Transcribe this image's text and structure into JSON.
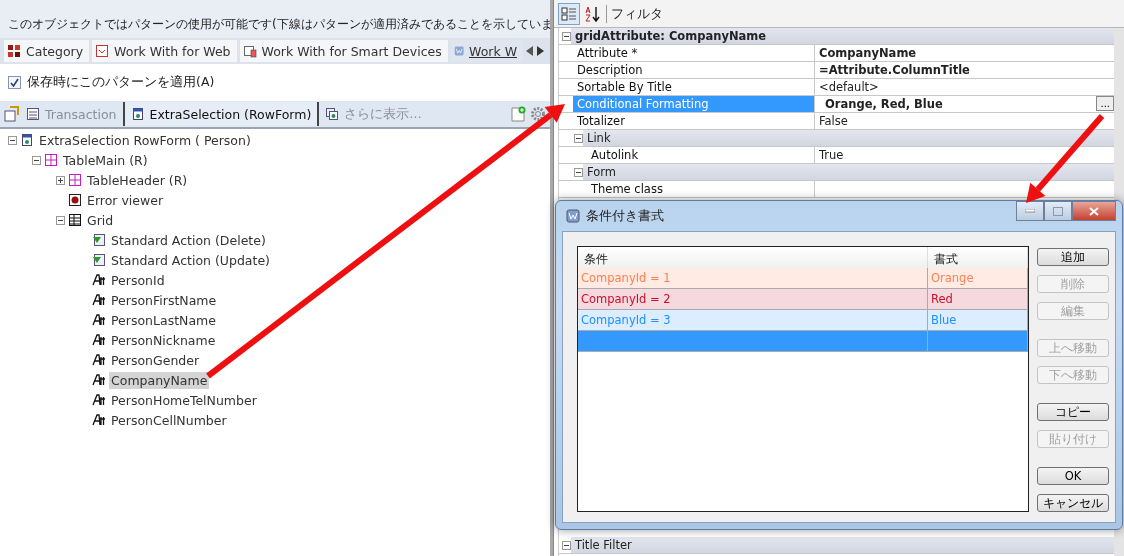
{
  "left_panel": {
    "notice": "このオブジェクトではパターンの使用が可能です(下線はパターンが適用済みであることを示していま",
    "tabs": [
      {
        "label": "Category",
        "kind": "category",
        "selected": false
      },
      {
        "label": "Work With for Web",
        "kind": "web",
        "selected": false
      },
      {
        "label": "Work With for Smart Devices",
        "kind": "devices",
        "selected": false
      },
      {
        "label": "Work W",
        "kind": "workwith",
        "selected": true
      }
    ],
    "apply_on_save": {
      "label": "保存時にこのパターンを適用(A)",
      "checked": true
    },
    "toolbar": [
      {
        "label": "Transaction",
        "kind": "transaction",
        "selected": false,
        "disabled": true
      },
      {
        "label": "ExtraSelection (RowForm)",
        "kind": "form",
        "selected": true,
        "disabled": false
      },
      {
        "label": "さらに表示…",
        "kind": "more",
        "selected": false,
        "disabled": true
      }
    ],
    "tree": [
      {
        "label": "ExtraSelection RowForm ( Person)",
        "kind": "form",
        "expanded": true,
        "selected": false,
        "children": [
          {
            "label": "TableMain (R)",
            "kind": "table",
            "expanded": true,
            "selected": false,
            "children": [
              {
                "label": "TableHeader (R)",
                "kind": "table",
                "expanded": false,
                "selected": false
              },
              {
                "label": "Error viewer",
                "kind": "error",
                "selected": false
              },
              {
                "label": "Grid",
                "kind": "grid",
                "expanded": true,
                "selected": false,
                "children": [
                  {
                    "label": "Standard Action (Delete)",
                    "kind": "action",
                    "selected": false
                  },
                  {
                    "label": "Standard Action (Update)",
                    "kind": "action",
                    "selected": false
                  },
                  {
                    "label": "PersonId",
                    "kind": "attribute",
                    "selected": false
                  },
                  {
                    "label": "PersonFirstName",
                    "kind": "attribute",
                    "selected": false
                  },
                  {
                    "label": "PersonLastName",
                    "kind": "attribute",
                    "selected": false
                  },
                  {
                    "label": "PersonNickname",
                    "kind": "attribute",
                    "selected": false
                  },
                  {
                    "label": "PersonGender",
                    "kind": "attribute",
                    "selected": false
                  },
                  {
                    "label": "CompanyName",
                    "kind": "attribute",
                    "selected": true
                  },
                  {
                    "label": "PersonHomeTelNumber",
                    "kind": "attribute",
                    "selected": false
                  },
                  {
                    "label": "PersonCellNumber",
                    "kind": "attribute",
                    "selected": false
                  }
                ]
              }
            ]
          }
        ]
      }
    ]
  },
  "property_panel": {
    "toolbar": {
      "categorized_selected": true,
      "filter_label": "フィルタ"
    },
    "sections": [
      {
        "title": "gridAttribute: CompanyName",
        "expanded": true,
        "items": [
          {
            "kind": "property",
            "name": "Attribute *",
            "value": "CompanyName",
            "bold": true,
            "selected": false
          },
          {
            "kind": "property",
            "name": "Description",
            "value": "=Attribute.ColumnTitle",
            "bold": true,
            "selected": false
          },
          {
            "kind": "property",
            "name": "Sortable By Title",
            "value": "<default>",
            "bold": false,
            "selected": false
          },
          {
            "kind": "property",
            "name": "Conditional Formatting",
            "value": "Orange, Red, Blue",
            "bold": true,
            "selected": true,
            "ellipsis": "..."
          },
          {
            "kind": "property",
            "name": "Totalizer",
            "value": "False",
            "bold": false,
            "selected": false
          },
          {
            "kind": "category",
            "title": "Link",
            "expanded": true,
            "items": [
              {
                "kind": "property",
                "name": "Autolink",
                "value": "True",
                "bold": false,
                "selected": false
              }
            ]
          },
          {
            "kind": "category",
            "title": "Form",
            "expanded": true,
            "items": [
              {
                "kind": "property",
                "name": "Theme class",
                "selected": false
              }
            ]
          }
        ]
      },
      {
        "title": "Title Filter",
        "expanded": true
      }
    ]
  },
  "dialog": {
    "title": "条件付き書式",
    "columns": [
      "条件",
      "書式"
    ],
    "rows": [
      {
        "condition": "CompanyId = 1",
        "format": "Orange",
        "color": "#ff7f50",
        "selected": false
      },
      {
        "condition": "CompanyId = 2",
        "format": "Red",
        "color": "#c8102e",
        "selected": false
      },
      {
        "condition": "CompanyId = 3",
        "format": "Blue",
        "color": "#1e90ff",
        "selected": false
      },
      {
        "selected": true
      }
    ],
    "button_groups": [
      [
        {
          "label": "追加",
          "disabled": false
        },
        {
          "label": "削除",
          "disabled": true
        },
        {
          "label": "編集",
          "disabled": true
        }
      ],
      [
        {
          "label": "上へ移動",
          "disabled": true
        },
        {
          "label": "下へ移動",
          "disabled": true
        }
      ],
      [
        {
          "label": "コピー",
          "disabled": false
        },
        {
          "label": "貼り付け",
          "disabled": true
        }
      ],
      [
        {
          "label": "OK",
          "disabled": false
        },
        {
          "label": "キャンセル",
          "disabled": false
        }
      ]
    ]
  }
}
